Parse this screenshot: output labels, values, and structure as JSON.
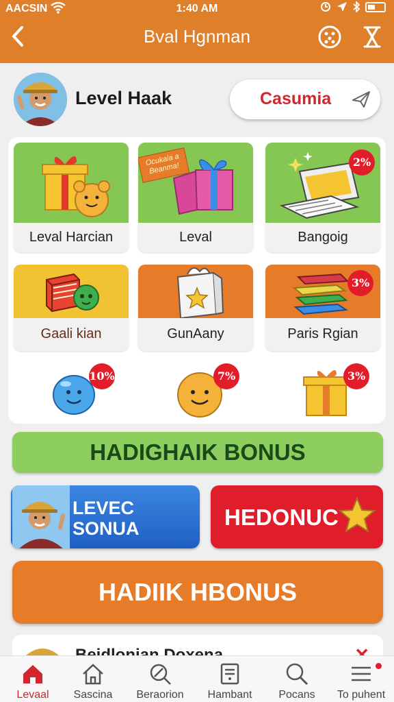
{
  "status": {
    "carrier": "AACSIN",
    "time": "1:40 AM"
  },
  "header": {
    "title": "Bval Hgnman"
  },
  "profile": {
    "name": "Level Haak",
    "action_label": "Casumia"
  },
  "tiles": [
    {
      "label": "Leval Harcian",
      "bg": "#86c653"
    },
    {
      "label": "Leval",
      "bg": "#86c653",
      "ribbon": "Ocukala a Beanma!"
    },
    {
      "label": "Bangoig",
      "bg": "#86c653",
      "badge": "2%"
    },
    {
      "label": "Gaali kian",
      "bg": "#f1c232"
    },
    {
      "label": "GunAany",
      "bg": "#e67c2a"
    },
    {
      "label": "Paris Rgian",
      "bg": "#e67c2a",
      "badge": "3%"
    }
  ],
  "mini_items": [
    {
      "badge": "10%"
    },
    {
      "badge": "7%"
    },
    {
      "badge": "3%"
    }
  ],
  "banners": {
    "green": "HADIGHAIK BONUS",
    "blue_line1": "LEVEC",
    "blue_line2": "SONUA",
    "red": "HEDONUC",
    "orange": "HADIIK HBONUS"
  },
  "peek": {
    "text": "Beidlonian Doxena"
  },
  "nav": [
    {
      "label": "Levaal",
      "icon": "home-icon",
      "active": true
    },
    {
      "label": "Sascina",
      "icon": "house-outline-icon"
    },
    {
      "label": "Beraorion",
      "icon": "search-slash-icon"
    },
    {
      "label": "Hambant",
      "icon": "document-icon"
    },
    {
      "label": "Pocans",
      "icon": "search-icon"
    },
    {
      "label": "To puhent",
      "icon": "menu-icon"
    }
  ],
  "colors": {
    "accent": "#e07f2a",
    "red": "#e21d2a",
    "green": "#8ece5e",
    "blue": "#2a70d2"
  }
}
